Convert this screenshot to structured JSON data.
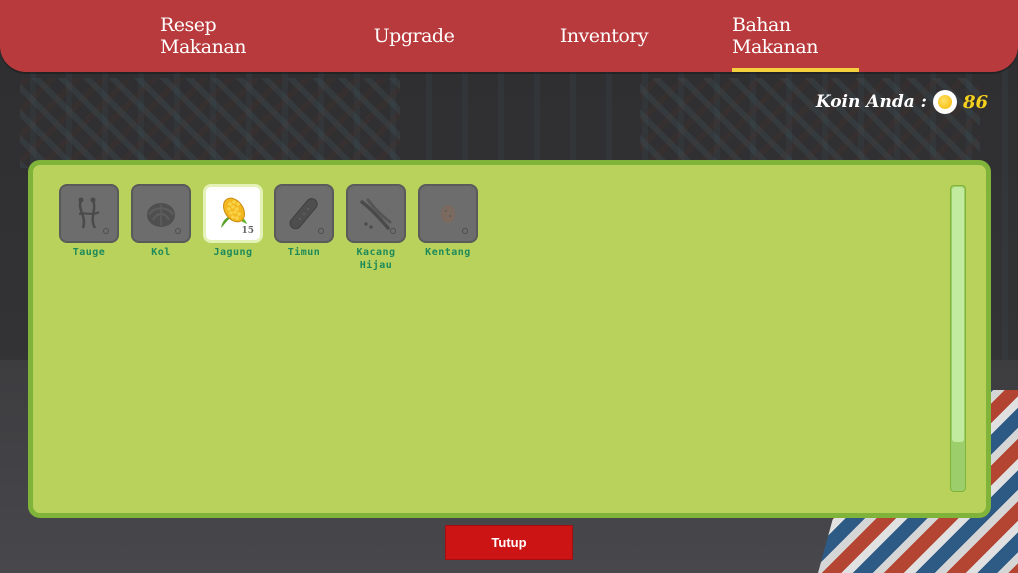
{
  "tabs": [
    {
      "label": "Resep Makanan",
      "active": false
    },
    {
      "label": "Upgrade",
      "active": false
    },
    {
      "label": "Inventory",
      "active": false
    },
    {
      "label": "Bahan Makanan",
      "active": true
    }
  ],
  "coins": {
    "label": "Koin Anda :",
    "value": "86",
    "icon": "coin-icon"
  },
  "items": [
    {
      "name": "Tauge",
      "icon": "bean-sprout-icon",
      "owned": false
    },
    {
      "name": "Kol",
      "icon": "cabbage-icon",
      "owned": false
    },
    {
      "name": "Jagung",
      "icon": "corn-icon",
      "owned": true,
      "count": "15"
    },
    {
      "name": "Timun",
      "icon": "cucumber-icon",
      "owned": false
    },
    {
      "name": "Kacang Hijau",
      "icon": "green-bean-icon",
      "owned": false
    },
    {
      "name": "Kentang",
      "icon": "potato-icon",
      "owned": false
    }
  ],
  "close_button": {
    "label": "Tutup"
  },
  "colors": {
    "header_red": "#b83a3c",
    "active_tab_underline": "#f4d03f",
    "panel_green": "#b9d25c",
    "panel_border": "#7fb33a",
    "coin_text": "#f7d21c",
    "close_button_red": "#cc1414",
    "item_label_green": "#1e8a5a"
  }
}
